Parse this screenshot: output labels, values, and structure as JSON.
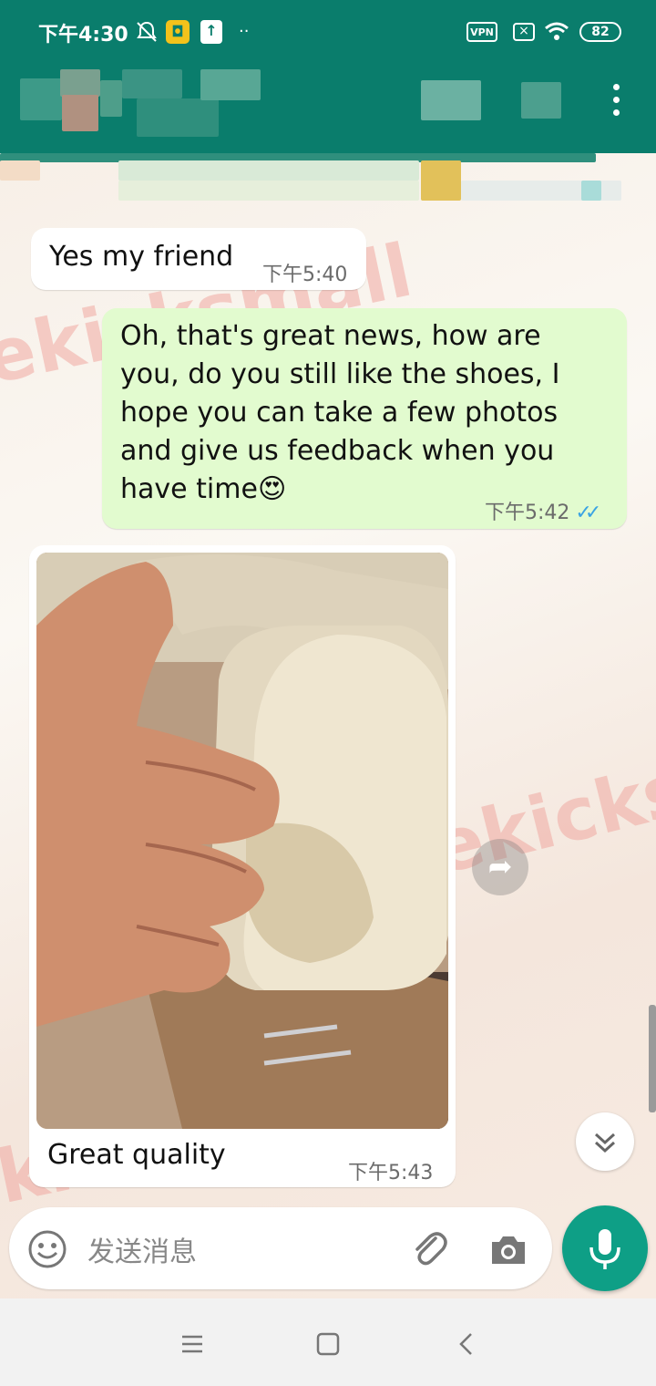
{
  "status_bar": {
    "time": "下午4:30",
    "vpn_label": "VPN",
    "battery": "82",
    "overflow": "··"
  },
  "header": {
    "more_options_icon": "vertical-dots-icon"
  },
  "messages": [
    {
      "direction": "incoming",
      "text": "Yes my friend",
      "time": "下午5:40"
    },
    {
      "direction": "outgoing",
      "text_lines": [
        "Oh, that's great news, how are",
        "you, do you still like the shoes, I",
        "hope you can take a few photos",
        "and give us feedback when you",
        "have time"
      ],
      "emoji": "😍",
      "time": "下午5:42",
      "status": "read",
      "ticks": "✓✓"
    },
    {
      "direction": "incoming",
      "type": "image",
      "caption": "Great quality",
      "time": "下午5:43"
    }
  ],
  "watermark": "ekicksmall",
  "composer": {
    "placeholder": "发送消息"
  },
  "colors": {
    "header": "#0a7d6c",
    "outgoing_bubble": "#e2fbcf",
    "mic_button": "#0e9f86",
    "read_ticks": "#3aa3e3"
  }
}
